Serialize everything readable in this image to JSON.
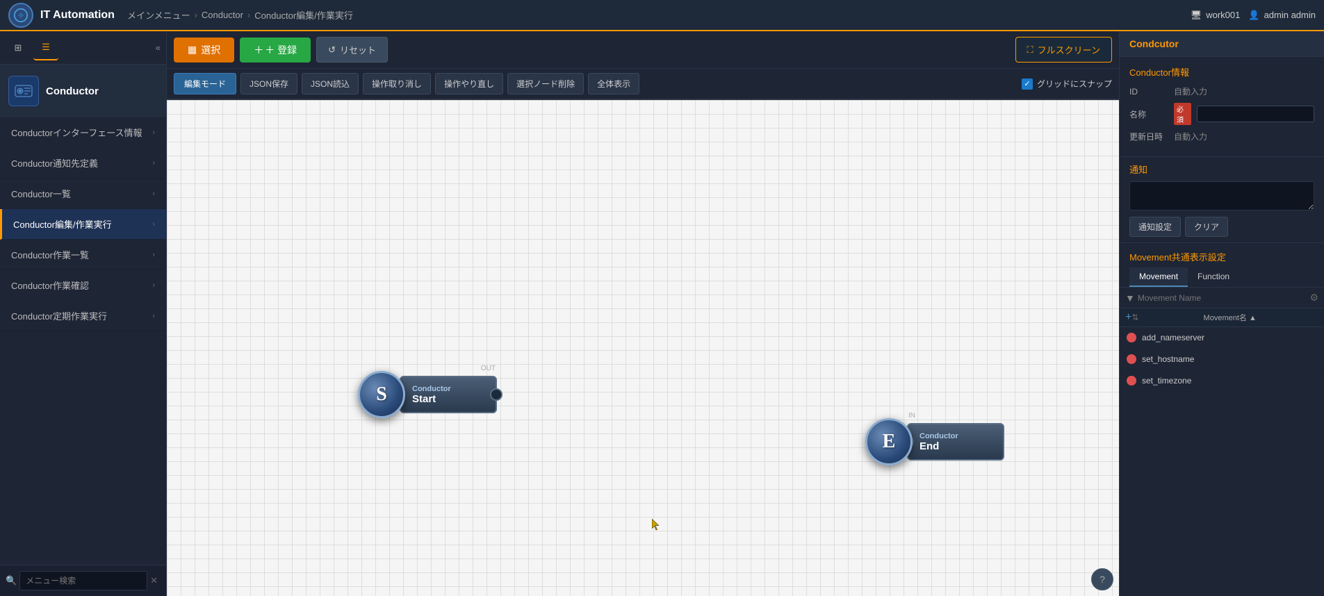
{
  "header": {
    "title": "IT Automation",
    "breadcrumb": [
      "メインメニュー",
      "Conductor",
      "Conductor編集/作業実行"
    ],
    "workspace": "work001",
    "user": "admin admin"
  },
  "toolbar": {
    "select_label": "選択",
    "register_label": "＋ 登録",
    "reset_label": "リセット",
    "fullscreen_label": "フルスクリーン"
  },
  "toolbar2": {
    "edit_mode": "編集モード",
    "json_save": "JSON保存",
    "json_load": "JSON読込",
    "undo": "操作取り消し",
    "redo": "操作やり直し",
    "delete_selected": "選択ノード削除",
    "show_all": "全体表示",
    "grid_snap": "グリッドにスナップ"
  },
  "sidebar": {
    "conductor_label": "Conductor",
    "menu_items": [
      {
        "label": "Conductorインターフェース情報",
        "has_sub": true
      },
      {
        "label": "Conductor通知先定義",
        "has_sub": true
      },
      {
        "label": "Conductor一覧",
        "has_sub": true
      },
      {
        "label": "Conductor編集/作業実行",
        "has_sub": true,
        "active": true
      },
      {
        "label": "Conductor作業一覧",
        "has_sub": true
      },
      {
        "label": "Conductor作業確認",
        "has_sub": true
      },
      {
        "label": "Conductor定期作業実行",
        "has_sub": true
      }
    ],
    "search_placeholder": "メニュー検索"
  },
  "start_node": {
    "label_top": "Conductor",
    "label_main": "Start",
    "out_label": "OUT",
    "letter": "S"
  },
  "end_node": {
    "label_top": "Conductor",
    "label_main": "End",
    "in_label": "IN",
    "letter": "E"
  },
  "right_panel": {
    "title": "Condcutor",
    "section_title": "Conductor情報",
    "id_label": "ID",
    "id_value": "自動入力",
    "name_label": "名称",
    "required_badge": "必須",
    "updated_label": "更新日時",
    "updated_value": "自動入力",
    "notification_title": "通知",
    "notification_settings_btn": "通知設定",
    "clear_btn": "クリア",
    "movement_display_title": "Movement共通表示設定",
    "tabs": [
      "Movement",
      "Function"
    ],
    "active_tab": 0,
    "filter_placeholder": "Movement Name",
    "column_label": "Movement名 ▲",
    "movements": [
      {
        "name": "add_nameserver",
        "color": "#e05050"
      },
      {
        "name": "set_hostname",
        "color": "#e05050"
      },
      {
        "name": "set_timezone",
        "color": "#e05050"
      }
    ]
  }
}
